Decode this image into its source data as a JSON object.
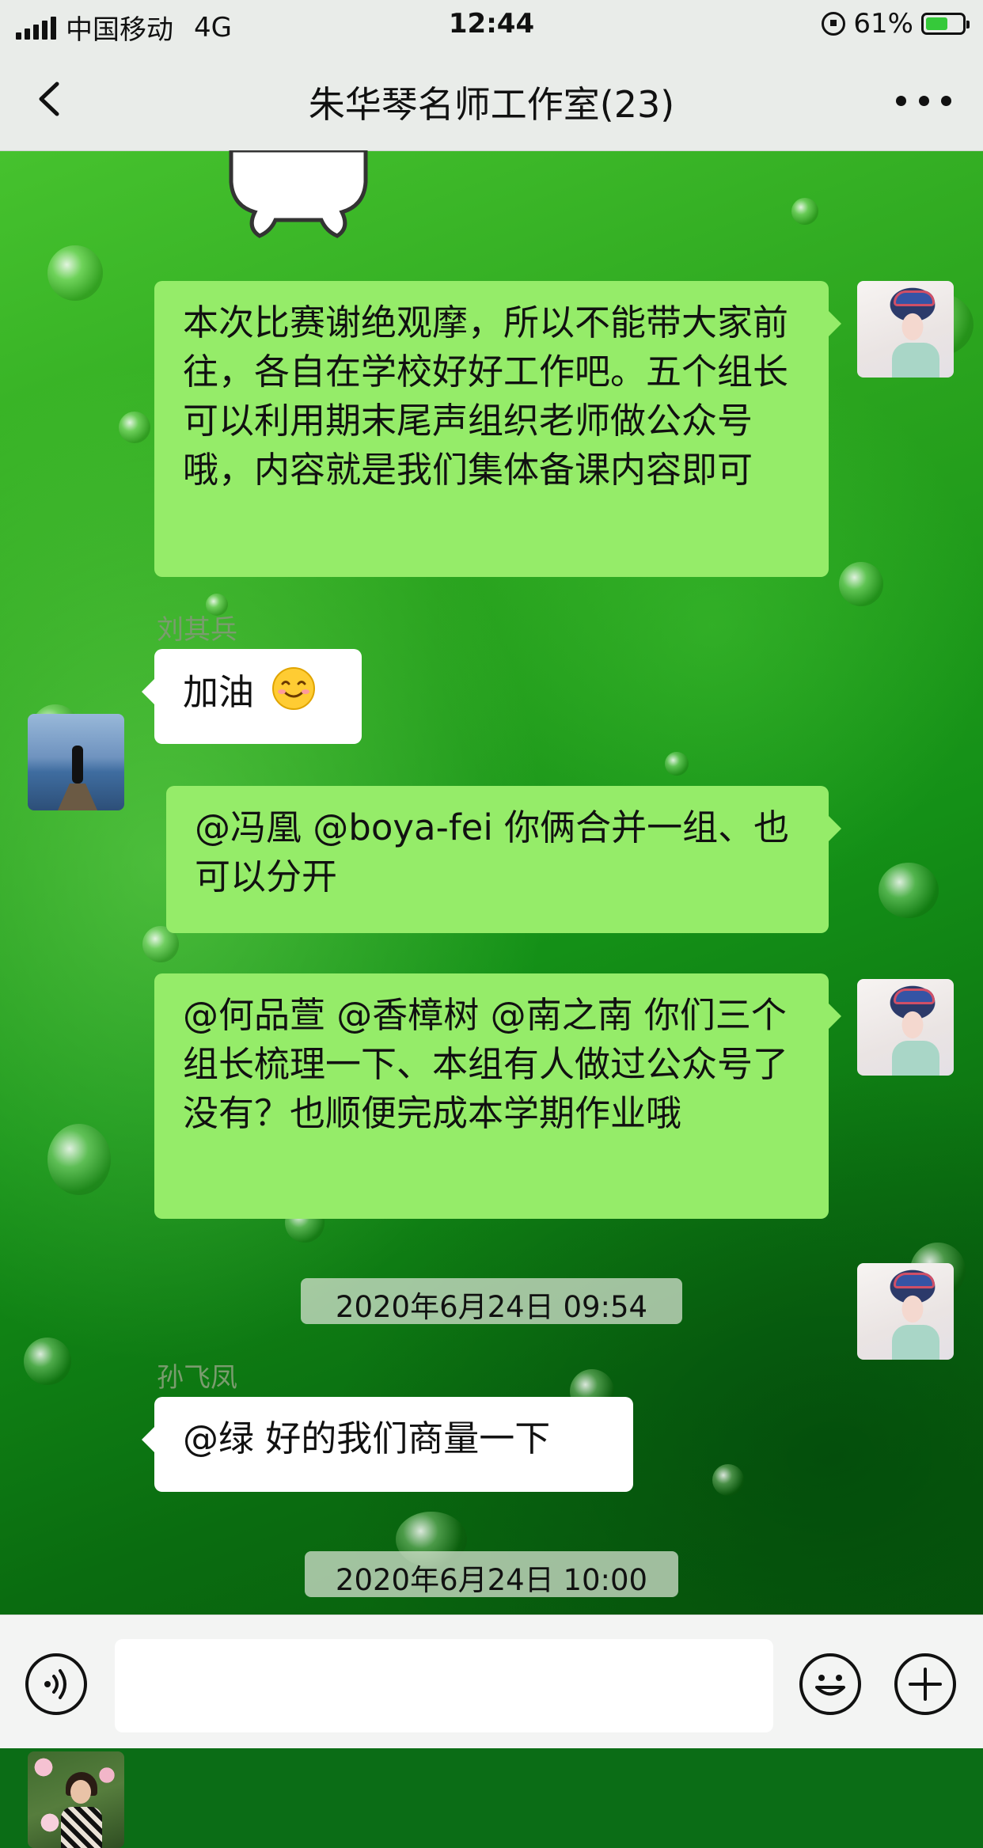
{
  "status_bar": {
    "carrier": "中国移动",
    "network": "4G",
    "time": "12:44",
    "battery": "61%",
    "battery_level": 0.61
  },
  "nav": {
    "title": "朱华琴名师工作室(23)",
    "back_icon": "chevron-left-icon",
    "more_icon": "more-dots-icon"
  },
  "messages": [
    {
      "side": "right",
      "text": "本次比赛谢绝观摩，所以不能带大家前往，各自在学校好好工作吧。五个组长可以利用期末尾声组织老师做公众号哦，内容就是我们集体备课内容即可"
    },
    {
      "side": "left",
      "sender": "刘其兵",
      "text": "加油"
    },
    {
      "side": "right",
      "text": "@冯凰 @boya-fei 你俩合并一组、也可以分开"
    },
    {
      "side": "right",
      "text": "@何品萱 @香樟树 @南之南 你们三个组长梳理一下、本组有人做过公众号了没有？也顺便完成本学期作业哦"
    },
    {
      "type": "timestamp",
      "text": "2020年6月24日 09:54"
    },
    {
      "side": "left",
      "sender": "孙飞凤",
      "text": "@绿 好的我们商量一下"
    },
    {
      "type": "timestamp",
      "text": "2020年6月24日 10:00"
    }
  ],
  "colors": {
    "self_bubble": "#95ec69",
    "other_bubble": "#ffffff",
    "bar_background": "#e9ece9"
  },
  "input_bar": {
    "voice_icon": "voice-icon",
    "emoji_icon": "emoji-icon",
    "plus_icon": "plus-icon",
    "text": ""
  }
}
